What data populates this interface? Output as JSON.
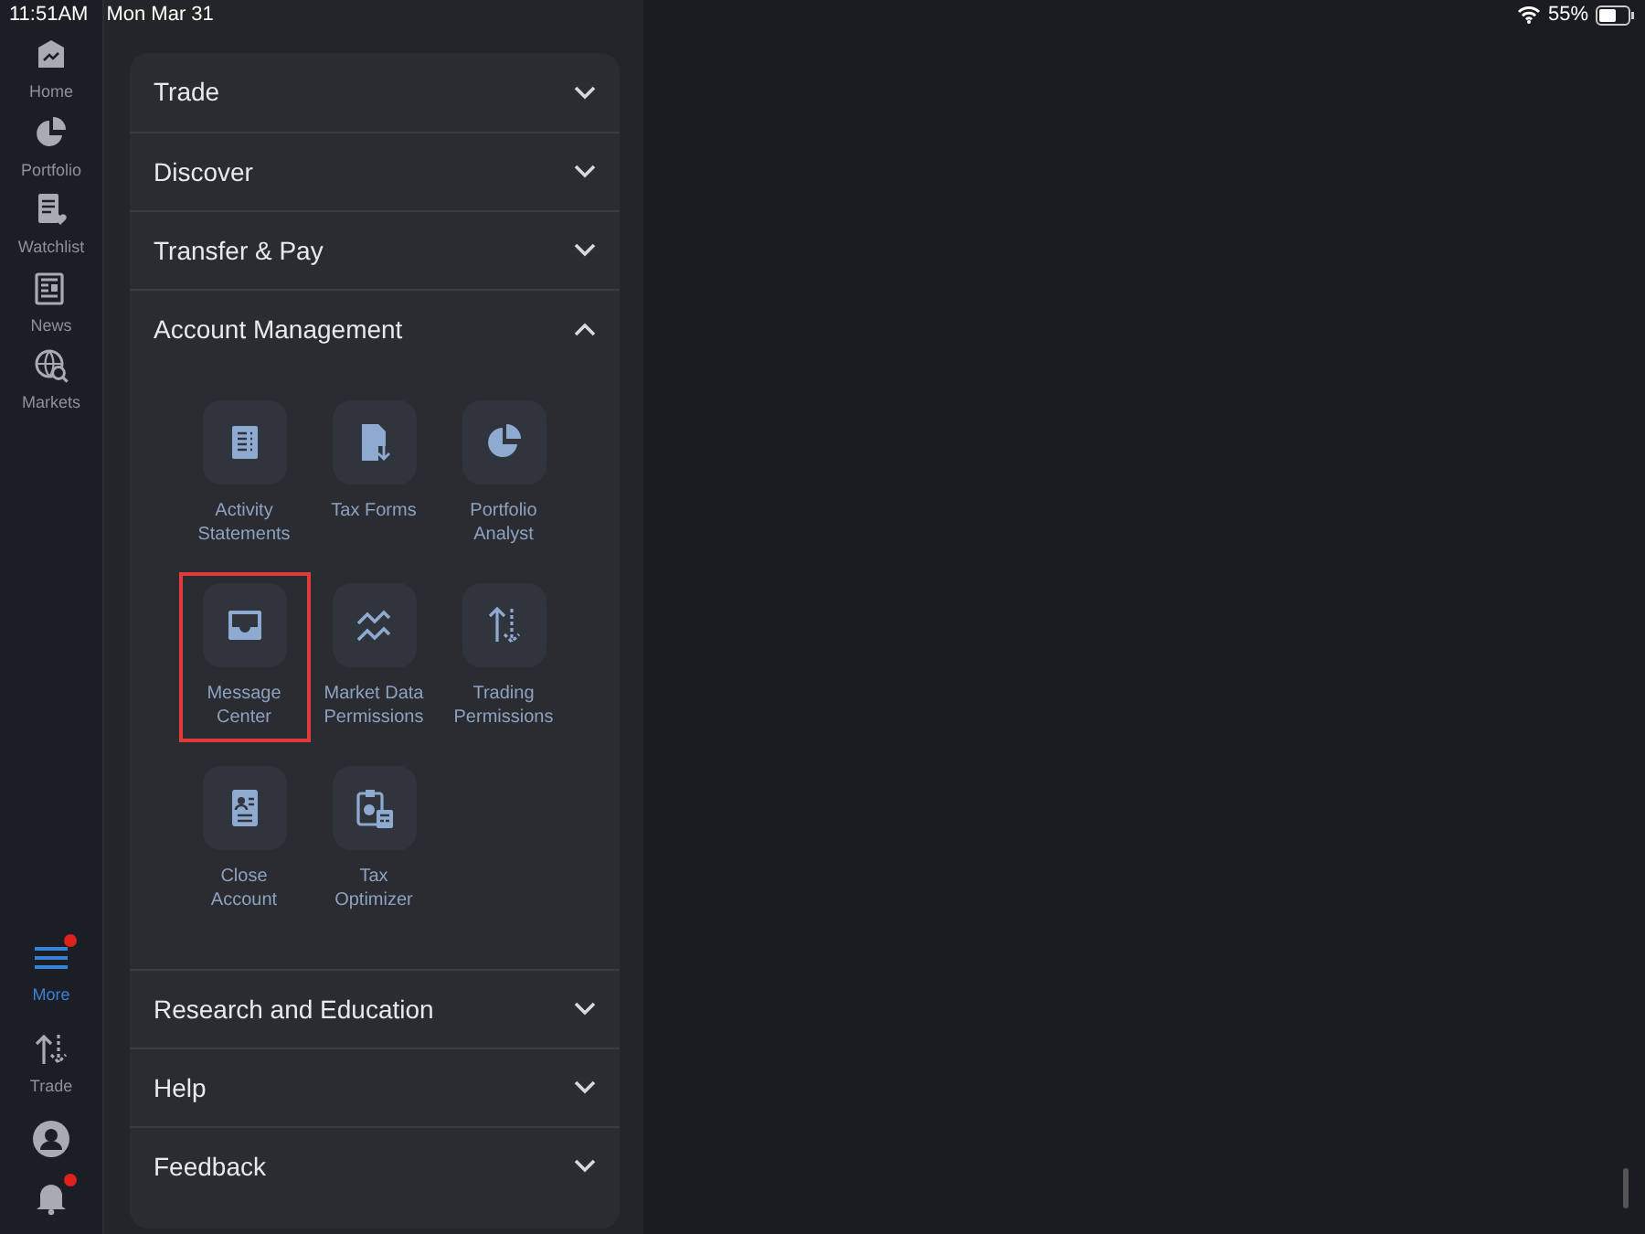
{
  "status_bar": {
    "time": "11:51AM",
    "date": "Mon Mar 31",
    "battery": "55%"
  },
  "nav_top": [
    {
      "kind": "home",
      "label": "Home",
      "selected": false
    },
    {
      "kind": "portfolio",
      "label": "Portfolio",
      "selected": false
    },
    {
      "kind": "watchlist",
      "label": "Watchlist",
      "selected": false
    },
    {
      "kind": "news",
      "label": "News",
      "selected": false
    },
    {
      "kind": "markets",
      "label": "Markets",
      "selected": false
    }
  ],
  "nav_bottom": [
    {
      "kind": "more",
      "label": "More",
      "selected": true,
      "badge": true
    },
    {
      "kind": "trade",
      "label": "Trade",
      "selected": false,
      "badge": false
    },
    {
      "kind": "profile",
      "selected": false,
      "badge": false
    },
    {
      "kind": "bell",
      "selected": false,
      "badge": true
    }
  ],
  "sections": [
    {
      "title": "Trade",
      "expanded": false
    },
    {
      "title": "Discover",
      "expanded": false
    },
    {
      "title": "Transfer & Pay",
      "expanded": false
    },
    {
      "title": "Account Management",
      "expanded": true,
      "items": [
        {
          "kind": "statements",
          "label": "Activity Statements",
          "highlighted": false
        },
        {
          "kind": "taxforms",
          "label": "Tax Forms",
          "highlighted": false
        },
        {
          "kind": "pie",
          "label": "Portfolio Analyst",
          "highlighted": false
        },
        {
          "kind": "inbox",
          "label": "Message Center",
          "highlighted": true
        },
        {
          "kind": "chart",
          "label": "Market Data Permissions",
          "highlighted": false
        },
        {
          "kind": "updown",
          "label": "Trading Permissions",
          "highlighted": false
        },
        {
          "kind": "idcard",
          "label": "Close Account",
          "highlighted": false
        },
        {
          "kind": "calc",
          "label": "Tax Optimizer",
          "highlighted": false
        }
      ]
    },
    {
      "title": "Research and Education",
      "expanded": false
    },
    {
      "title": "Help",
      "expanded": false
    },
    {
      "title": "Feedback",
      "expanded": false
    }
  ]
}
